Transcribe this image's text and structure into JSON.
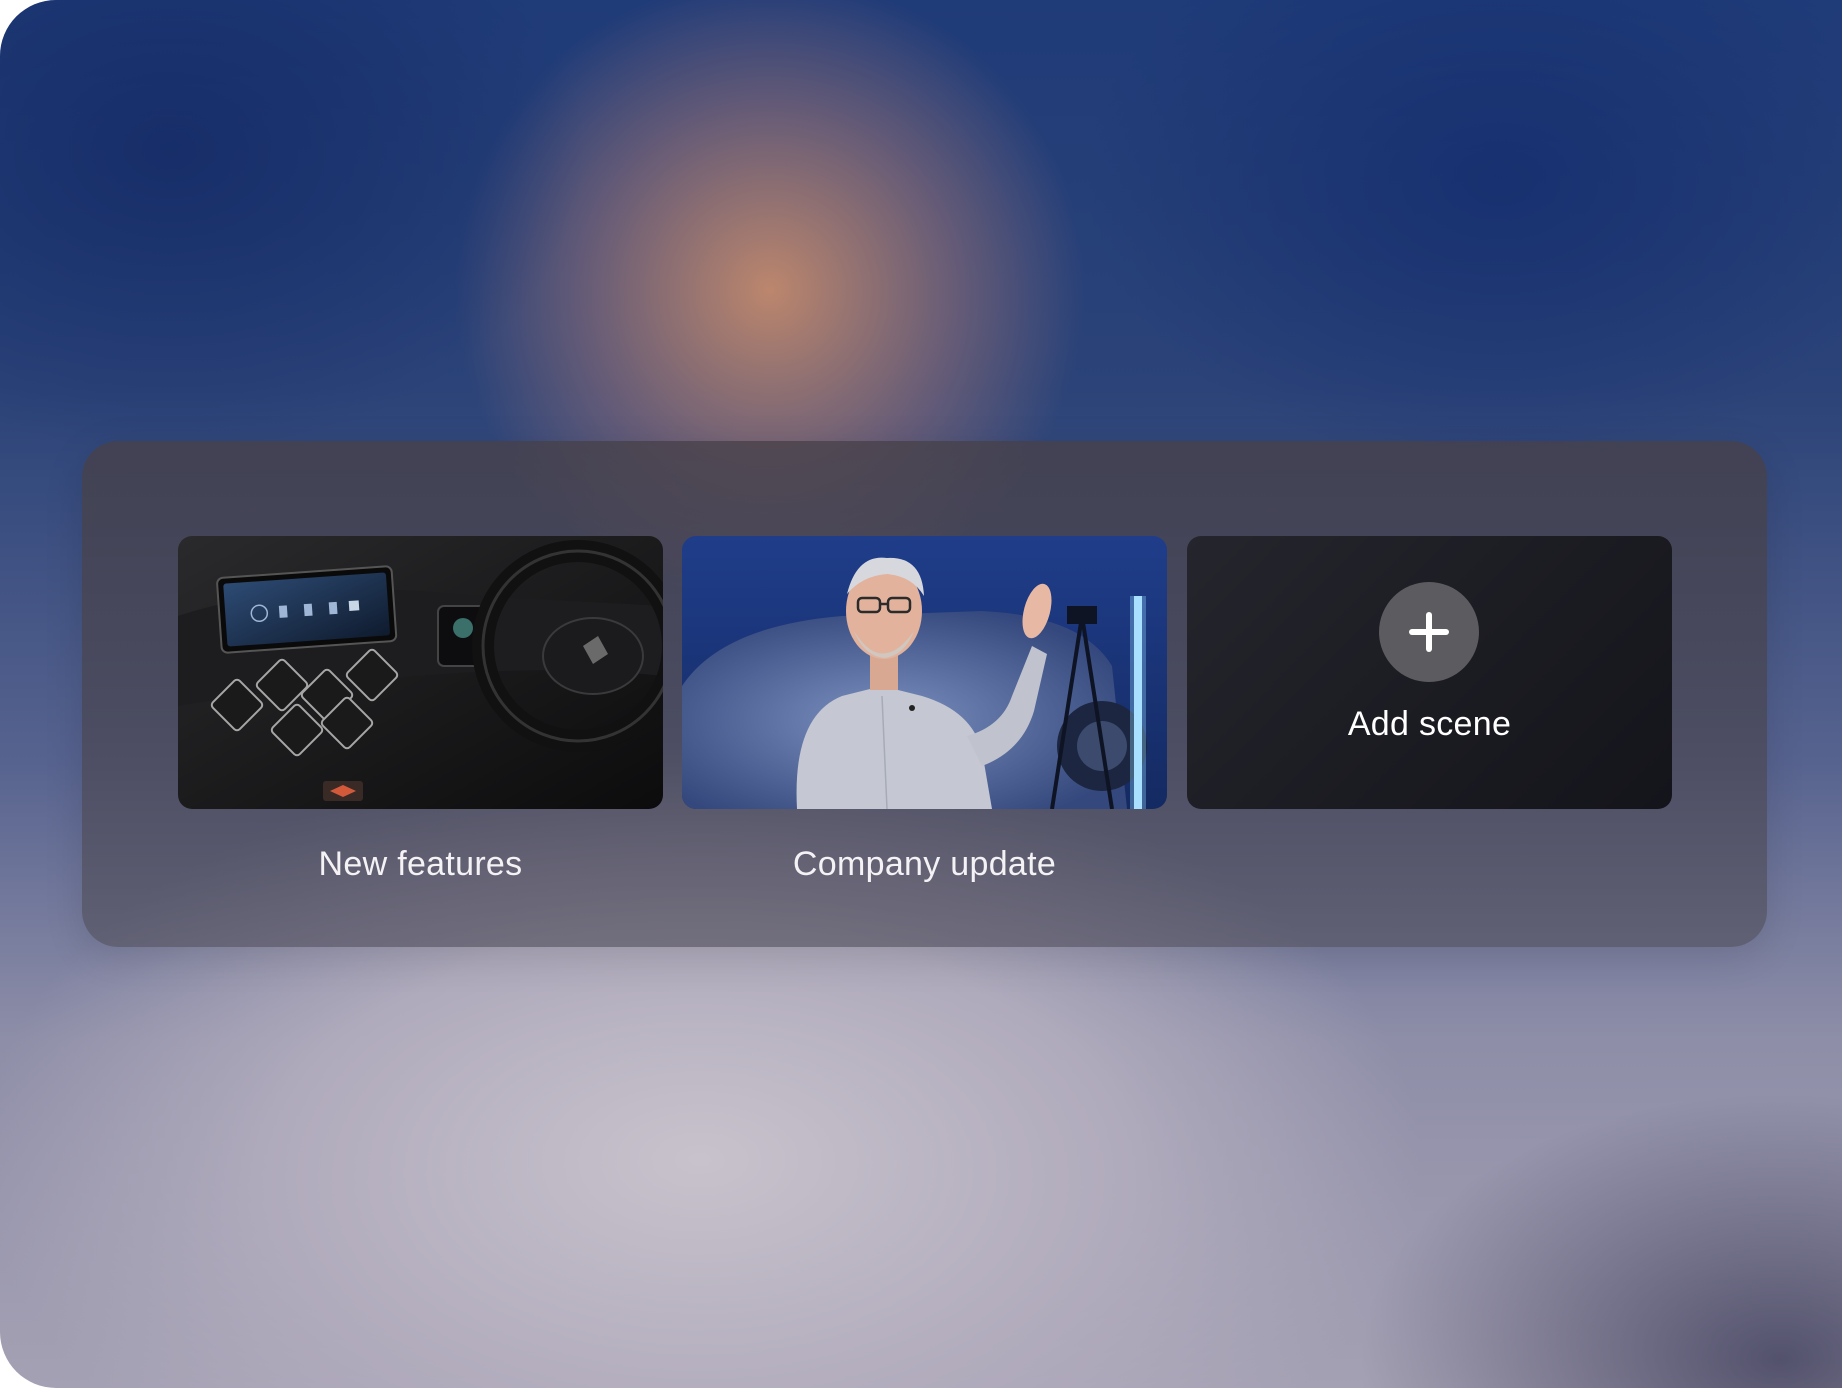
{
  "scenes": [
    {
      "title": "New features",
      "thumbnail_icon": "car-dashboard-thumbnail"
    },
    {
      "title": "Company update",
      "thumbnail_icon": "presenter-thumbnail"
    }
  ],
  "add_scene": {
    "label": "Add scene",
    "icon": "plus-icon"
  },
  "colors": {
    "panel": "#48444f",
    "add_card": "#1b1b22",
    "add_circle": "#5b5b60",
    "text": "#f4f2f4"
  }
}
